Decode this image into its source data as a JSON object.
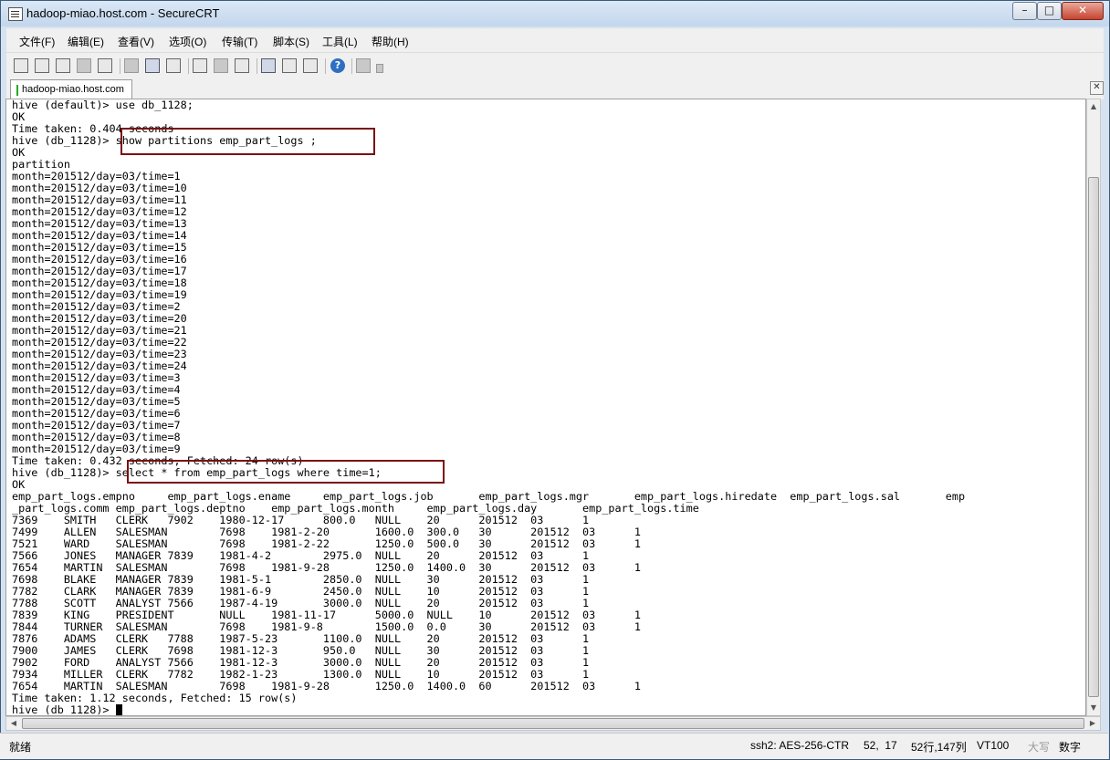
{
  "window": {
    "title": "hadoop-miao.host.com - SecureCRT"
  },
  "menu": [
    "文件(F)",
    "编辑(E)",
    "查看(V)",
    "选项(O)",
    "传输(T)",
    "脚本(S)",
    "工具(L)",
    "帮助(H)"
  ],
  "toolbar": {
    "help_glyph": "?"
  },
  "tab": {
    "label": "hadoop-miao.host.com"
  },
  "terminal": {
    "lines": [
      "hive (default)> use db_1128;",
      "OK",
      "Time taken: 0.404 seconds",
      "hive (db_1128)> show partitions emp_part_logs ;",
      "OK",
      "partition",
      "month=201512/day=03/time=1",
      "month=201512/day=03/time=10",
      "month=201512/day=03/time=11",
      "month=201512/day=03/time=12",
      "month=201512/day=03/time=13",
      "month=201512/day=03/time=14",
      "month=201512/day=03/time=15",
      "month=201512/day=03/time=16",
      "month=201512/day=03/time=17",
      "month=201512/day=03/time=18",
      "month=201512/day=03/time=19",
      "month=201512/day=03/time=2",
      "month=201512/day=03/time=20",
      "month=201512/day=03/time=21",
      "month=201512/day=03/time=22",
      "month=201512/day=03/time=23",
      "month=201512/day=03/time=24",
      "month=201512/day=03/time=3",
      "month=201512/day=03/time=4",
      "month=201512/day=03/time=5",
      "month=201512/day=03/time=6",
      "month=201512/day=03/time=7",
      "month=201512/day=03/time=8",
      "month=201512/day=03/time=9",
      "Time taken: 0.432 seconds, Fetched: 24 row(s)",
      "hive (db_1128)> select * from emp_part_logs where time=1;",
      "OK",
      "emp_part_logs.empno     emp_part_logs.ename     emp_part_logs.job       emp_part_logs.mgr       emp_part_logs.hiredate  emp_part_logs.sal       emp",
      "_part_logs.comm emp_part_logs.deptno    emp_part_logs.month     emp_part_logs.day       emp_part_logs.time",
      "7369    SMITH   CLERK   7902    1980-12-17      800.0   NULL    20      201512  03      1",
      "7499    ALLEN   SALESMAN        7698    1981-2-20       1600.0  300.0   30      201512  03      1",
      "7521    WARD    SALESMAN        7698    1981-2-22       1250.0  500.0   30      201512  03      1",
      "7566    JONES   MANAGER 7839    1981-4-2        2975.0  NULL    20      201512  03      1",
      "7654    MARTIN  SALESMAN        7698    1981-9-28       1250.0  1400.0  30      201512  03      1",
      "7698    BLAKE   MANAGER 7839    1981-5-1        2850.0  NULL    30      201512  03      1",
      "7782    CLARK   MANAGER 7839    1981-6-9        2450.0  NULL    10      201512  03      1",
      "7788    SCOTT   ANALYST 7566    1987-4-19       3000.0  NULL    20      201512  03      1",
      "7839    KING    PRESIDENT       NULL    1981-11-17      5000.0  NULL    10      201512  03      1",
      "7844    TURNER  SALESMAN        7698    1981-9-8        1500.0  0.0     30      201512  03      1",
      "7876    ADAMS   CLERK   7788    1987-5-23       1100.0  NULL    20      201512  03      1",
      "7900    JAMES   CLERK   7698    1981-12-3       950.0   NULL    30      201512  03      1",
      "7902    FORD    ANALYST 7566    1981-12-3       3000.0  NULL    20      201512  03      1",
      "7934    MILLER  CLERK   7782    1982-1-23       1300.0  NULL    10      201512  03      1",
      "7654    MARTIN  SALESMAN        7698    1981-9-28       1250.0  1400.0  60      201512  03      1",
      "Time taken: 1.12 seconds, Fetched: 15 row(s)"
    ],
    "prompt": "hive (db_1128)> "
  },
  "status": {
    "ready": "就绪",
    "cipher": "ssh2: AES-256-CTR",
    "cursor_pos": "52,  17",
    "size": "52行,147列",
    "emulation": "VT100",
    "caps": "大写",
    "num": "数字"
  }
}
